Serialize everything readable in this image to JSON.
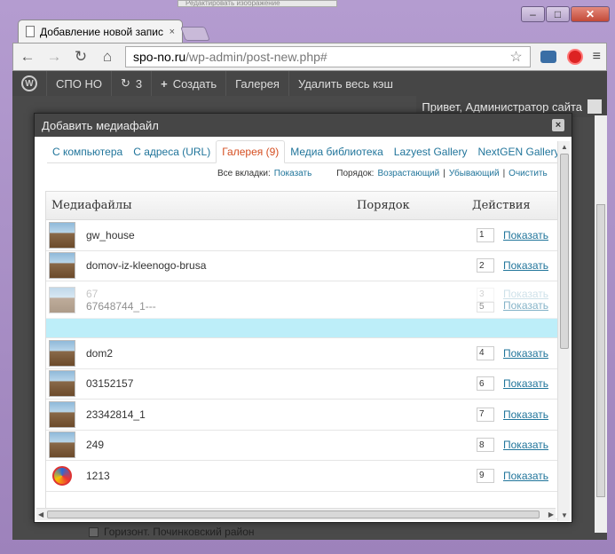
{
  "browser": {
    "tab_title": "Добавление новой запис",
    "tab_close": "×",
    "top_strip": "Редактировать изображение",
    "url_domain": "spo-no.ru",
    "url_path": "/wp-admin/post-new.php#",
    "back": "←",
    "forward": "→",
    "reload": "↻",
    "home": "⌂",
    "star": "☆",
    "menu": "≡",
    "min": "–",
    "max": "□",
    "close": "✕"
  },
  "wpbar": {
    "logo": "W",
    "site": "СПО НО",
    "updates": "3",
    "updates_icon": "↻",
    "create_icon": "+",
    "create": "Создать",
    "gallery": "Галерея",
    "cache": "Удалить весь кэш",
    "greeting": "Привет, Администратор сайта"
  },
  "modal": {
    "title": "Добавить медиафайл",
    "close": "×",
    "tabs": [
      {
        "label": "С компьютера"
      },
      {
        "label": "С адреса (URL)"
      },
      {
        "label": "Галерея (9)"
      },
      {
        "label": "Медиа библиотека"
      },
      {
        "label": "Lazyest Gallery"
      },
      {
        "label": "NextGEN Gallery"
      }
    ],
    "all_tabs_label": "Все вкладки:",
    "all_tabs_show": "Показать",
    "order_label": "Порядок:",
    "order_asc": "Возрастающий",
    "order_desc": "Убывающий",
    "order_clear": "Очистить",
    "sep": "|",
    "columns": {
      "media": "Медиафайлы",
      "order": "Порядок",
      "actions": "Действия"
    },
    "show_label": "Показать",
    "rows": [
      {
        "name": "gw_house",
        "order": "1"
      },
      {
        "name": "domov-iz-kleenogo-brusa",
        "order": "2"
      }
    ],
    "drag_row": {
      "name_a": "67",
      "name_b": "67648744_1---",
      "order_a": "3",
      "order_b": "5"
    },
    "rows2": [
      {
        "name": "dom2",
        "order": "4"
      },
      {
        "name": "03152157",
        "order": "6"
      },
      {
        "name": "23342814_1",
        "order": "7"
      },
      {
        "name": "249",
        "order": "8"
      },
      {
        "name": "1213",
        "order": "9"
      }
    ]
  },
  "behind": {
    "text": "Горизонт. Починковский район"
  }
}
